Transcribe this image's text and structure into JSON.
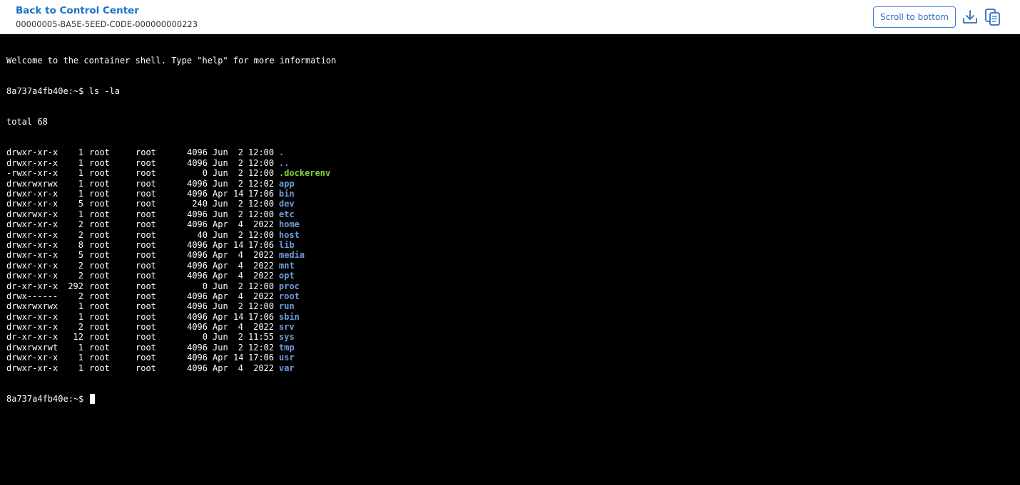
{
  "header": {
    "back_label": "Back to Control Center",
    "container_id": "00000005-BA5E-5EED-C0DE-000000000223",
    "scroll_label": "Scroll to bottom",
    "download_icon": "download-icon",
    "copy_icon": "copy-icon",
    "accent_color": "#1a73c8"
  },
  "terminal": {
    "welcome": "Welcome to the container shell. Type \"help\" for more information",
    "command_line": "8a737a4fb40e:~$ ls -la",
    "total": "total 68",
    "prompt": "8a737a4fb40e:~$ ",
    "colors": {
      "background": "#000000",
      "text": "#ffffff",
      "directory": "#6e9bd8",
      "file": "#7ed23d"
    },
    "entries": [
      {
        "perms": "drwxr-xr-x",
        "links": "1",
        "owner": "root",
        "group": "root",
        "size": "4096",
        "month": "Jun",
        "day": "2",
        "time": "12:00",
        "name": ".",
        "type": "dir"
      },
      {
        "perms": "drwxr-xr-x",
        "links": "1",
        "owner": "root",
        "group": "root",
        "size": "4096",
        "month": "Jun",
        "day": "2",
        "time": "12:00",
        "name": "..",
        "type": "dir"
      },
      {
        "perms": "-rwxr-xr-x",
        "links": "1",
        "owner": "root",
        "group": "root",
        "size": "0",
        "month": "Jun",
        "day": "2",
        "time": "12:00",
        "name": ".dockerenv",
        "type": "file"
      },
      {
        "perms": "drwxrwxrwx",
        "links": "1",
        "owner": "root",
        "group": "root",
        "size": "4096",
        "month": "Jun",
        "day": "2",
        "time": "12:02",
        "name": "app",
        "type": "dir"
      },
      {
        "perms": "drwxr-xr-x",
        "links": "1",
        "owner": "root",
        "group": "root",
        "size": "4096",
        "month": "Apr",
        "day": "14",
        "time": "17:06",
        "name": "bin",
        "type": "dir"
      },
      {
        "perms": "drwxr-xr-x",
        "links": "5",
        "owner": "root",
        "group": "root",
        "size": "240",
        "month": "Jun",
        "day": "2",
        "time": "12:00",
        "name": "dev",
        "type": "dir"
      },
      {
        "perms": "drwxrwxr-x",
        "links": "1",
        "owner": "root",
        "group": "root",
        "size": "4096",
        "month": "Jun",
        "day": "2",
        "time": "12:00",
        "name": "etc",
        "type": "dir"
      },
      {
        "perms": "drwxr-xr-x",
        "links": "2",
        "owner": "root",
        "group": "root",
        "size": "4096",
        "month": "Apr",
        "day": "4",
        "time": "2022",
        "name": "home",
        "type": "dir"
      },
      {
        "perms": "drwxr-xr-x",
        "links": "2",
        "owner": "root",
        "group": "root",
        "size": "40",
        "month": "Jun",
        "day": "2",
        "time": "12:00",
        "name": "host",
        "type": "dir"
      },
      {
        "perms": "drwxr-xr-x",
        "links": "8",
        "owner": "root",
        "group": "root",
        "size": "4096",
        "month": "Apr",
        "day": "14",
        "time": "17:06",
        "name": "lib",
        "type": "dir"
      },
      {
        "perms": "drwxr-xr-x",
        "links": "5",
        "owner": "root",
        "group": "root",
        "size": "4096",
        "month": "Apr",
        "day": "4",
        "time": "2022",
        "name": "media",
        "type": "dir"
      },
      {
        "perms": "drwxr-xr-x",
        "links": "2",
        "owner": "root",
        "group": "root",
        "size": "4096",
        "month": "Apr",
        "day": "4",
        "time": "2022",
        "name": "mnt",
        "type": "dir"
      },
      {
        "perms": "drwxr-xr-x",
        "links": "2",
        "owner": "root",
        "group": "root",
        "size": "4096",
        "month": "Apr",
        "day": "4",
        "time": "2022",
        "name": "opt",
        "type": "dir"
      },
      {
        "perms": "dr-xr-xr-x",
        "links": "292",
        "owner": "root",
        "group": "root",
        "size": "0",
        "month": "Jun",
        "day": "2",
        "time": "12:00",
        "name": "proc",
        "type": "dir"
      },
      {
        "perms": "drwx------",
        "links": "2",
        "owner": "root",
        "group": "root",
        "size": "4096",
        "month": "Apr",
        "day": "4",
        "time": "2022",
        "name": "root",
        "type": "dir"
      },
      {
        "perms": "drwxrwxrwx",
        "links": "1",
        "owner": "root",
        "group": "root",
        "size": "4096",
        "month": "Jun",
        "day": "2",
        "time": "12:00",
        "name": "run",
        "type": "dir"
      },
      {
        "perms": "drwxr-xr-x",
        "links": "1",
        "owner": "root",
        "group": "root",
        "size": "4096",
        "month": "Apr",
        "day": "14",
        "time": "17:06",
        "name": "sbin",
        "type": "dir"
      },
      {
        "perms": "drwxr-xr-x",
        "links": "2",
        "owner": "root",
        "group": "root",
        "size": "4096",
        "month": "Apr",
        "day": "4",
        "time": "2022",
        "name": "srv",
        "type": "dir"
      },
      {
        "perms": "dr-xr-xr-x",
        "links": "12",
        "owner": "root",
        "group": "root",
        "size": "0",
        "month": "Jun",
        "day": "2",
        "time": "11:55",
        "name": "sys",
        "type": "dir"
      },
      {
        "perms": "drwxrwxrwt",
        "links": "1",
        "owner": "root",
        "group": "root",
        "size": "4096",
        "month": "Jun",
        "day": "2",
        "time": "12:02",
        "name": "tmp",
        "type": "dir"
      },
      {
        "perms": "drwxr-xr-x",
        "links": "1",
        "owner": "root",
        "group": "root",
        "size": "4096",
        "month": "Apr",
        "day": "14",
        "time": "17:06",
        "name": "usr",
        "type": "dir"
      },
      {
        "perms": "drwxr-xr-x",
        "links": "1",
        "owner": "root",
        "group": "root",
        "size": "4096",
        "month": "Apr",
        "day": "4",
        "time": "2022",
        "name": "var",
        "type": "dir"
      }
    ]
  }
}
